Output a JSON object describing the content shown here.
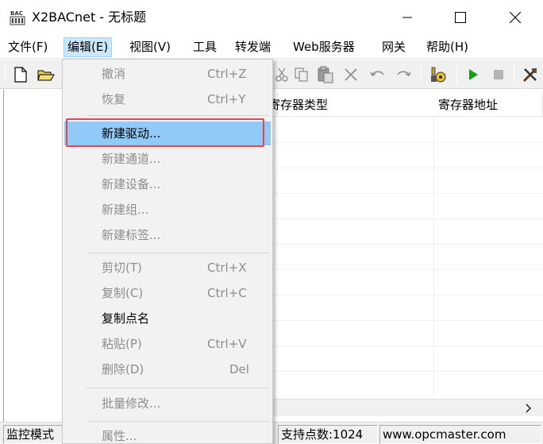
{
  "window": {
    "title": "X2BACnet - 无标题",
    "icon": "bac-app-icon"
  },
  "menubar": {
    "items": [
      {
        "label": "文件(F)"
      },
      {
        "label": "编辑(E)"
      },
      {
        "label": "视图(V)"
      },
      {
        "label": "工具"
      },
      {
        "label": "转发端"
      },
      {
        "label": "Web服务器"
      },
      {
        "label": "网关"
      },
      {
        "label": "帮助(H)"
      }
    ]
  },
  "toolbar": {
    "icons": [
      "new-file-icon",
      "open-folder-icon",
      "cut-icon",
      "copy-icon",
      "paste-icon",
      "delete-icon",
      "undo-icon",
      "redo-icon",
      "debug-icon",
      "play-icon",
      "stop-icon",
      "tools-icon"
    ],
    "colors": {
      "play": "#14a014",
      "stop": "#b4b4b4"
    }
  },
  "list": {
    "columns": [
      {
        "label": "寄存器类型"
      },
      {
        "label": "寄存器地址"
      }
    ]
  },
  "status": {
    "left": "监控模式",
    "points": "支持点数:1024",
    "website": "www.opcmaster.com"
  },
  "dropdown": {
    "items": [
      {
        "label": "撤消",
        "shortcut": "Ctrl+Z",
        "enabled": false
      },
      {
        "label": "恢复",
        "shortcut": "Ctrl+Y",
        "enabled": false
      },
      {
        "label": "新建驱动...",
        "shortcut": "",
        "enabled": true,
        "highlighted": true
      },
      {
        "label": "新建通道...",
        "shortcut": "",
        "enabled": false
      },
      {
        "label": "新建设备...",
        "shortcut": "",
        "enabled": false
      },
      {
        "label": "新建组...",
        "shortcut": "",
        "enabled": false
      },
      {
        "label": "新建标签...",
        "shortcut": "",
        "enabled": false
      },
      {
        "label": "剪切(T)",
        "shortcut": "Ctrl+X",
        "enabled": false
      },
      {
        "label": "复制(C)",
        "shortcut": "Ctrl+C",
        "enabled": false
      },
      {
        "label": "复制点名",
        "shortcut": "",
        "enabled": true
      },
      {
        "label": "粘贴(P)",
        "shortcut": "Ctrl+V",
        "enabled": false
      },
      {
        "label": "删除(D)",
        "shortcut": "Del",
        "enabled": false
      },
      {
        "label": "批量修改...",
        "shortcut": "",
        "enabled": false
      },
      {
        "label": "属性...",
        "shortcut": "",
        "enabled": false
      }
    ],
    "highlight_color": "#91c9f7",
    "annotation_color": "#e0474f"
  }
}
